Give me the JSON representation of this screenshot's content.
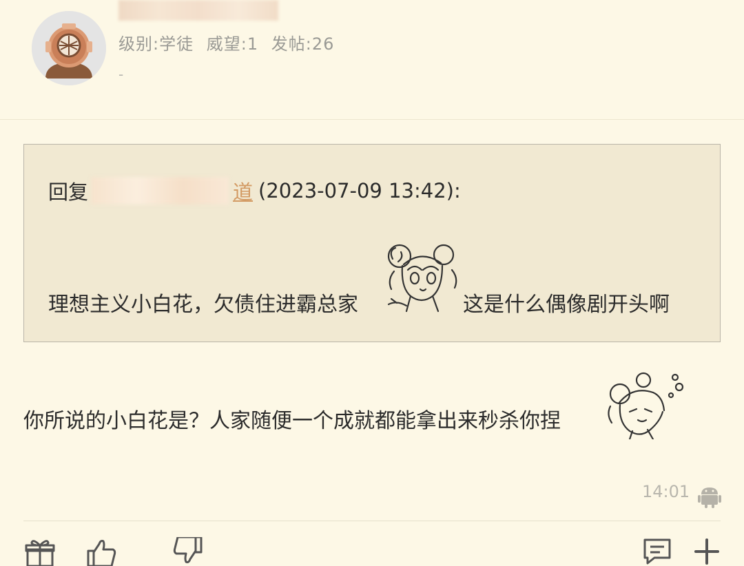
{
  "user": {
    "level_label": "级别:学徒",
    "prestige_label": "威望:1",
    "posts_label": "发帖:26",
    "signature": "-"
  },
  "quote": {
    "prefix": "回复",
    "name_suffix": "道",
    "timestamp": "(2023-07-09 13:42):",
    "text_before": "理想主义小白花，欠债住进霸总家",
    "text_after": "这是什么偶像剧开头啊"
  },
  "reply": {
    "text": "你所说的小白花是？人家随便一个成就都能拿出来秒杀你捏"
  },
  "footer": {
    "time": "14:01"
  },
  "icons": {
    "avatar": "diving-helmet-avatar",
    "device": "android-icon",
    "actions": [
      "gift-icon",
      "thumbs-up-icon",
      "thumbs-down-icon",
      "comment-icon",
      "plus-icon"
    ]
  }
}
